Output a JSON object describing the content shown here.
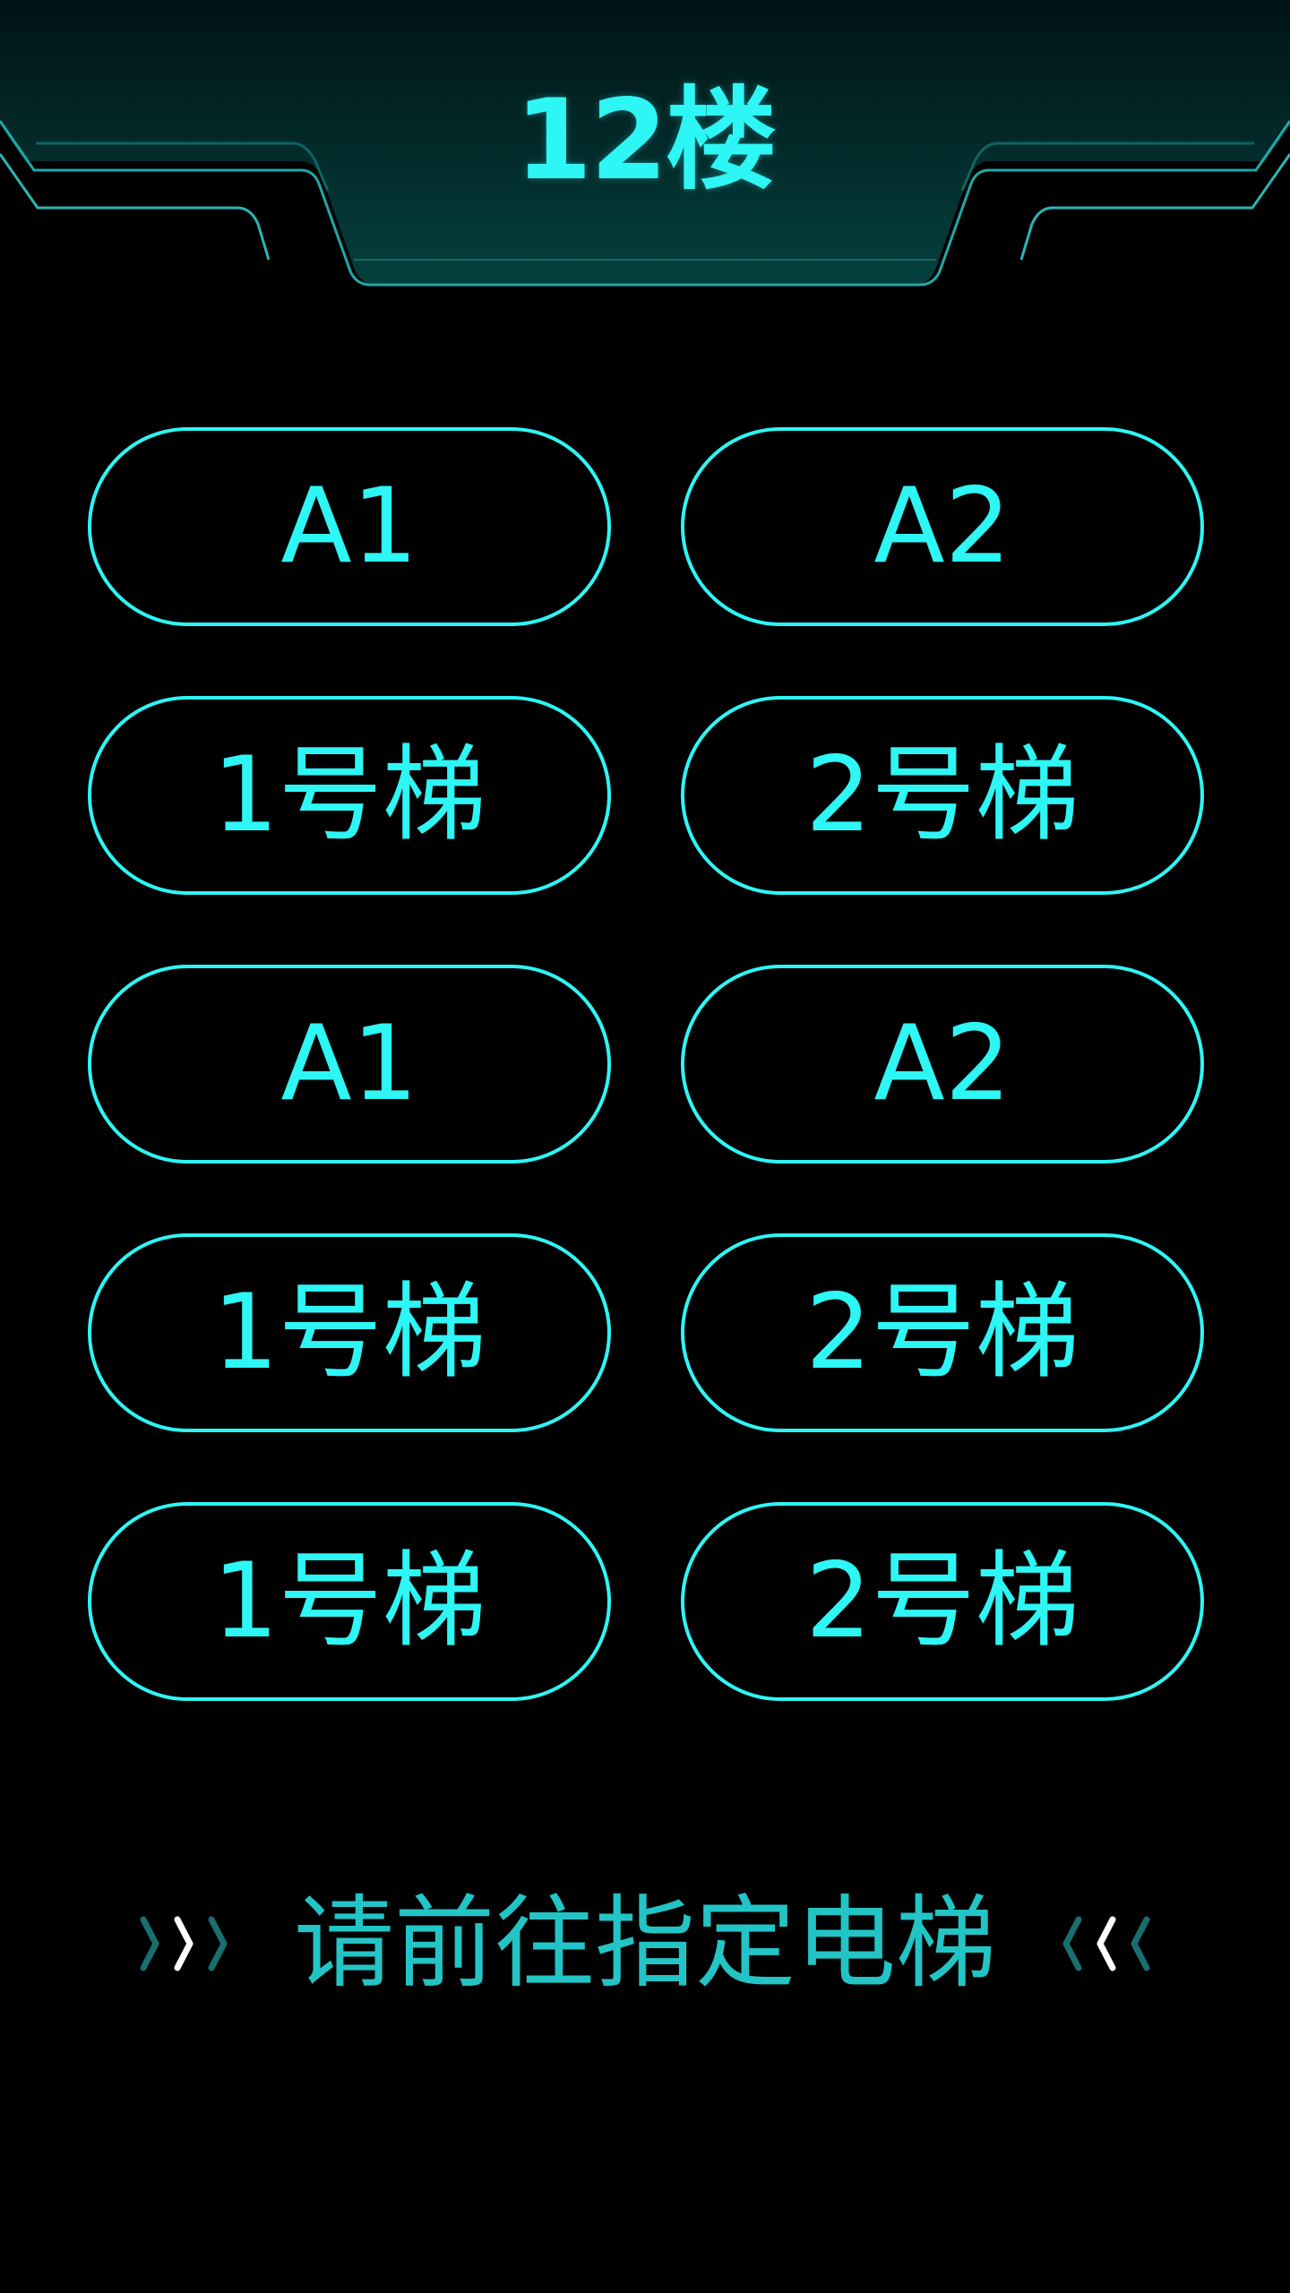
{
  "header": {
    "title": "12楼"
  },
  "elevators": [
    {
      "label": "A1"
    },
    {
      "label": "A2"
    },
    {
      "label": "1号梯"
    },
    {
      "label": "2号梯"
    },
    {
      "label": "A1"
    },
    {
      "label": "A2"
    },
    {
      "label": "1号梯"
    },
    {
      "label": "2号梯"
    },
    {
      "label": "1号梯"
    },
    {
      "label": "2号梯"
    }
  ],
  "hint": {
    "text": "请前往指定电梯"
  },
  "colors": {
    "accent": "#2ef6f5",
    "hint_text": "#23c4c6",
    "background": "#000000",
    "header_panel": "#033a38"
  },
  "icons": {
    "left": "chevron-right-triple-icon",
    "right": "chevron-left-triple-icon"
  }
}
